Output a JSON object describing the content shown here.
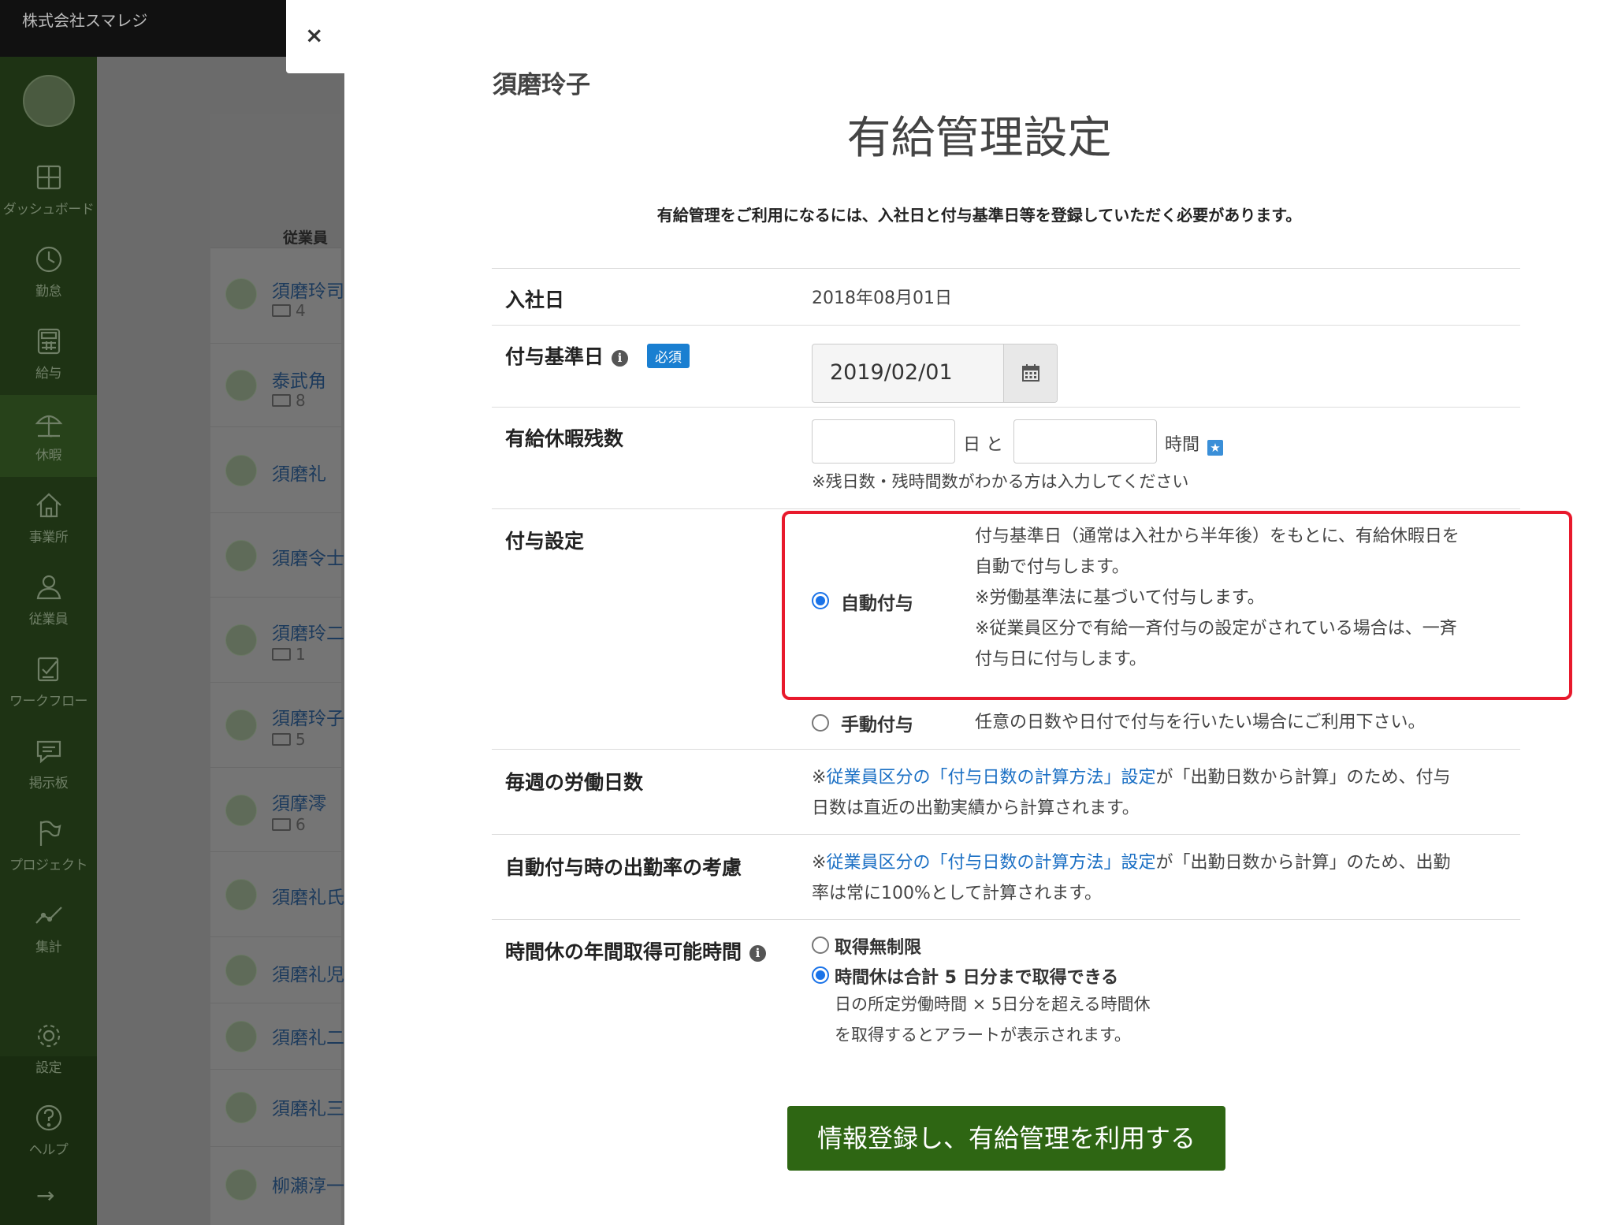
{
  "app": {
    "company": "株式会社スマレジ"
  },
  "sidebar": {
    "items": [
      {
        "label": "ダッシュボード",
        "icon": "dashboard-icon"
      },
      {
        "label": "勤怠",
        "icon": "clock-icon"
      },
      {
        "label": "給与",
        "icon": "calculator-icon"
      },
      {
        "label": "休暇",
        "icon": "umbrella-icon",
        "active": true
      },
      {
        "label": "事業所",
        "icon": "home-icon"
      },
      {
        "label": "従業員",
        "icon": "person-icon"
      },
      {
        "label": "ワークフロー",
        "icon": "checklist-icon"
      },
      {
        "label": "掲示板",
        "icon": "message-icon"
      },
      {
        "label": "プロジェクト",
        "icon": "flag-icon"
      },
      {
        "label": "集計",
        "icon": "chart-icon"
      },
      {
        "label": "設定",
        "icon": "gear-icon"
      },
      {
        "label": "ヘルプ",
        "icon": "help-icon"
      }
    ],
    "expand_arrow": "→"
  },
  "employee_list": {
    "header": "従業員",
    "rows": [
      {
        "name": "須磨玲司",
        "count": "4"
      },
      {
        "name": "泰武角",
        "count": "8"
      },
      {
        "name": "須磨礼",
        "count": ""
      },
      {
        "name": "須磨令士",
        "count": ""
      },
      {
        "name": "須磨玲二",
        "count": "1"
      },
      {
        "name": "須磨玲子",
        "count": "5"
      },
      {
        "name": "須摩澪",
        "count": "6"
      },
      {
        "name": "須磨礼氏",
        "count": ""
      },
      {
        "name": "須磨礼児",
        "count": ""
      },
      {
        "name": "須磨礼二",
        "count": ""
      },
      {
        "name": "須磨礼三",
        "count": ""
      },
      {
        "name": "柳瀬淳一",
        "count": ""
      }
    ]
  },
  "modal": {
    "close": "×",
    "employee_name": "須磨玲子",
    "title": "有給管理設定",
    "notice": "有給管理をご利用になるには、入社日と付与基準日等を登録していただく必要があります。",
    "hire_date": {
      "label": "入社日",
      "value": "2018年08月01日"
    },
    "grant_base_date": {
      "label": "付与基準日",
      "info": "i",
      "required": "必須",
      "value": "2019/02/01"
    },
    "remaining": {
      "label": "有給休暇残数",
      "days_unit": "日 と",
      "hours_unit": "時間",
      "star": "★",
      "hint": "※残日数・残時間数がわかる方は入力してください",
      "days_value": "",
      "hours_value": ""
    },
    "grant_setting": {
      "label": "付与設定",
      "auto": {
        "label": "自動付与",
        "selected": true,
        "desc": [
          "付与基準日（通常は入社から半年後）をもとに、有給休暇日を",
          "自動で付与します。",
          "※労働基準法に基づいて付与します。",
          "※従業員区分で有給一斉付与の設定がされている場合は、一斉",
          "付与日に付与します。"
        ]
      },
      "manual": {
        "label": "手動付与",
        "selected": false,
        "desc": "任意の日数や日付で付与を行いたい場合にご利用下さい。"
      }
    },
    "weekly_days": {
      "label": "毎週の労働日数",
      "prefix": "※",
      "link": "従業員区分の「付与日数の計算方法」設定",
      "suffix": "が「出勤日数から計算」のため、付与",
      "line2": "日数は直近の出勤実績から計算されます。"
    },
    "attendance_rate": {
      "label": "自動付与時の出勤率の考慮",
      "prefix": "※",
      "link": "従業員区分の「付与日数の計算方法」設定",
      "suffix": "が「出勤日数から計算」のため、出勤",
      "line2": "率は常に100%として計算されます。"
    },
    "hourly_leave": {
      "label": "時間休の年間取得可能時間",
      "info": "i",
      "option_unlimited": "取得無制限",
      "option_limited": "時間休は合計 5 日分まで取得できる",
      "selected": "limited",
      "desc_line1": "日の所定労働時間 × 5日分を超える時間休",
      "desc_line2": "を取得するとアラートが表示されます。"
    },
    "submit": "情報登録し、有給管理を利用する"
  },
  "colors": {
    "accent_green": "#2e6613",
    "required_blue": "#1a7fd1",
    "link_blue": "#1a6fc4",
    "highlight_red": "#e8192c"
  }
}
